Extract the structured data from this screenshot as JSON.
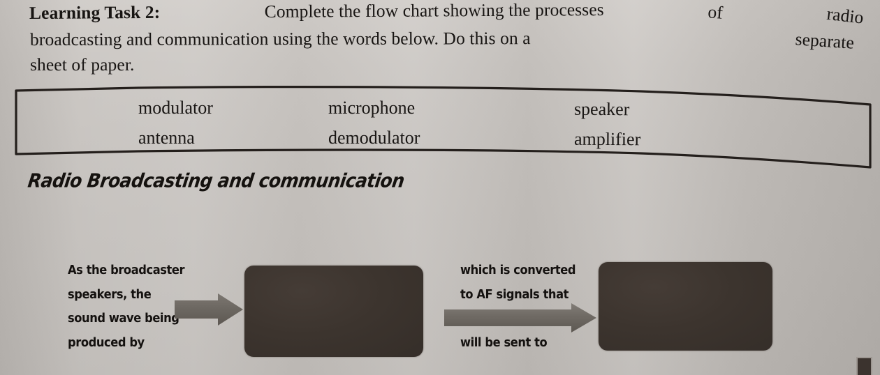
{
  "instructions": {
    "lead": "Learning Task 2:",
    "line1_rest": "Complete the flow chart showing the processes",
    "line1_tail1": "of",
    "line1_tail2": "radio",
    "line2": "broadcasting and communication using the words below. Do this on a",
    "line2_tail1": "separate",
    "line3": "sheet of paper.",
    "full_text": "Learning Task 2: Complete the flow chart showing the processes of radio broadcasting and communication using the words below. Do this on a separate sheet of paper."
  },
  "word_bank": {
    "rows": [
      [
        "modulator",
        "microphone",
        "speaker"
      ],
      [
        "antenna",
        "demodulator",
        "amplifier"
      ]
    ]
  },
  "heading": {
    "text": "Radio Broadcasting and communication"
  },
  "flowchart": {
    "text_block_1": [
      "As the broadcaster",
      "speakers, the",
      "sound wave being",
      "produced by"
    ],
    "text_block_2_top": [
      "which is converted",
      "to AF signals that"
    ],
    "text_block_2_bottom": [
      "will be sent to"
    ],
    "box_1_label": "",
    "box_2_label": "",
    "arrow_1": "arrow-right",
    "arrow_2": "arrow-right"
  },
  "colors": {
    "paper": "#c5c1bd",
    "ink": "#181513",
    "box_fill": "#3c342e",
    "arrow_fill": "#6f6a65"
  }
}
